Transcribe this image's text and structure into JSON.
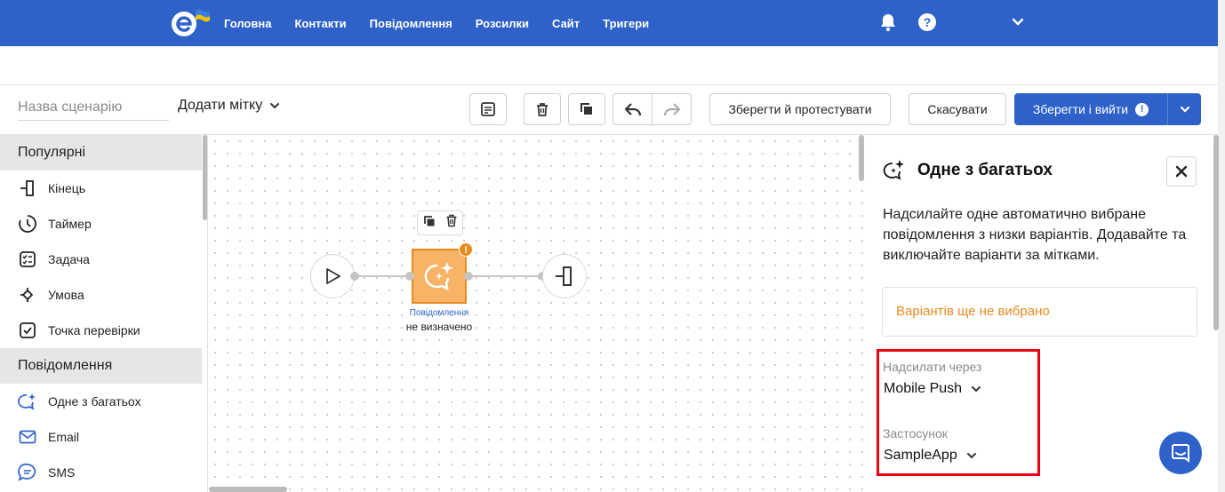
{
  "nav": {
    "items": [
      "Головна",
      "Контакти",
      "Повідомлення",
      "Розсилки",
      "Сайт",
      "Тригери"
    ]
  },
  "toolbar": {
    "name_placeholder": "Назва сценарію",
    "tag_label": "Додати мітку",
    "save_test_label": "Зберегти й протестувати",
    "cancel_label": "Скасувати",
    "save_exit_label": "Зберегти і вийти"
  },
  "sidebar": {
    "section_popular": "Популярні",
    "popular": [
      {
        "label": "Кінець",
        "icon": "end-icon"
      },
      {
        "label": "Таймер",
        "icon": "timer-icon"
      },
      {
        "label": "Задача",
        "icon": "task-icon"
      },
      {
        "label": "Умова",
        "icon": "condition-icon"
      },
      {
        "label": "Точка перевірки",
        "icon": "checkpoint-icon"
      }
    ],
    "section_messages": "Повідомлення",
    "messages": [
      {
        "label": "Одне з багатьох",
        "icon": "sparkle-chat-icon"
      },
      {
        "label": "Email",
        "icon": "email-icon"
      },
      {
        "label": "SMS",
        "icon": "sms-icon"
      }
    ]
  },
  "canvas": {
    "node_caption_type": "Повідомлення",
    "node_caption_status": "не визначено",
    "warning": "!"
  },
  "panel": {
    "title": "Одне з багатьох",
    "description": "Надсилайте одне автоматично вибране повідомлення з низки варіантів. Додавайте та виключайте варіанти за мітками.",
    "no_variants": "Варіантів ще не вибрано",
    "send_via_label": "Надсилати через",
    "send_via_value": "Mobile Push",
    "app_label": "Застосунок",
    "app_value": "SampleApp"
  },
  "colors": {
    "brand_blue": "#2e62c9",
    "warning_orange": "#e98a1f",
    "highlight_red": "#e60012"
  }
}
